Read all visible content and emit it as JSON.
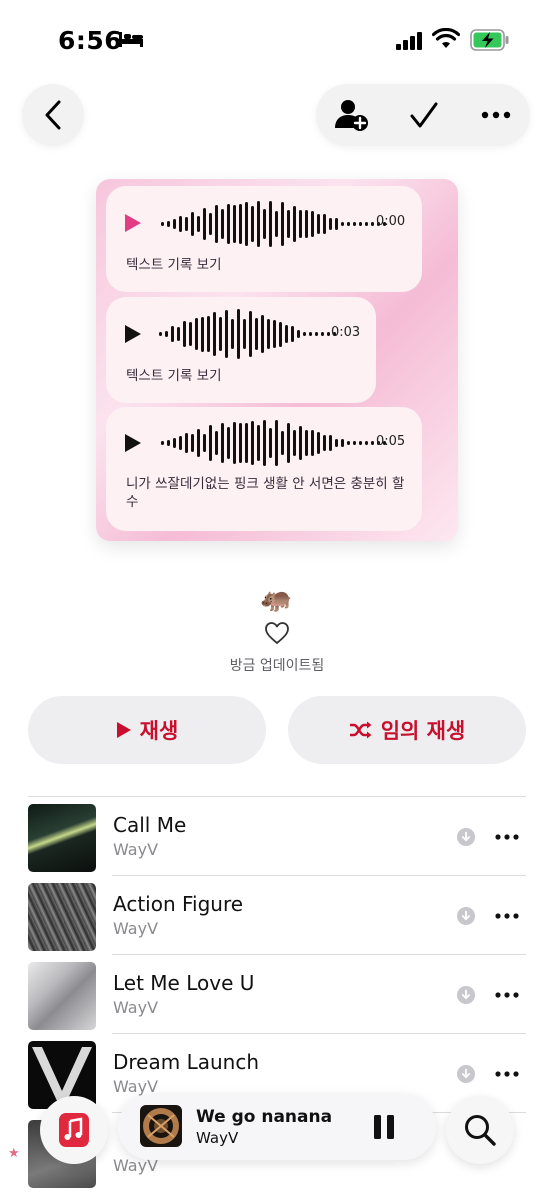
{
  "status_bar": {
    "time": "6:56"
  },
  "artwork": {
    "messages": [
      {
        "duration": "0:00",
        "caption": "텍스트 기록 보기",
        "playing": true
      },
      {
        "duration": "0:03",
        "caption": "텍스트 기록 보기",
        "playing": false
      },
      {
        "duration": "0:05",
        "caption": "니가 쓰잘데기없는 핑크 생활 안 서면은 충분히 할 수",
        "playing": false
      }
    ]
  },
  "playlist": {
    "emoji": "🦛",
    "updated": "방금 업데이트됨"
  },
  "buttons": {
    "play": "재생",
    "shuffle": "임의 재생"
  },
  "songs": [
    {
      "title": "Call Me",
      "artist": "WayV"
    },
    {
      "title": "Action Figure",
      "artist": "WayV"
    },
    {
      "title": "Let Me Love U",
      "artist": "WayV"
    },
    {
      "title": "Dream Launch",
      "artist": "WayV"
    },
    {
      "title": "",
      "artist": "WayV"
    }
  ],
  "mini_player": {
    "title": "We go nanana",
    "artist": "WayV"
  },
  "colors": {
    "accent": "#c8102e",
    "play_pink": "#e23d84"
  }
}
